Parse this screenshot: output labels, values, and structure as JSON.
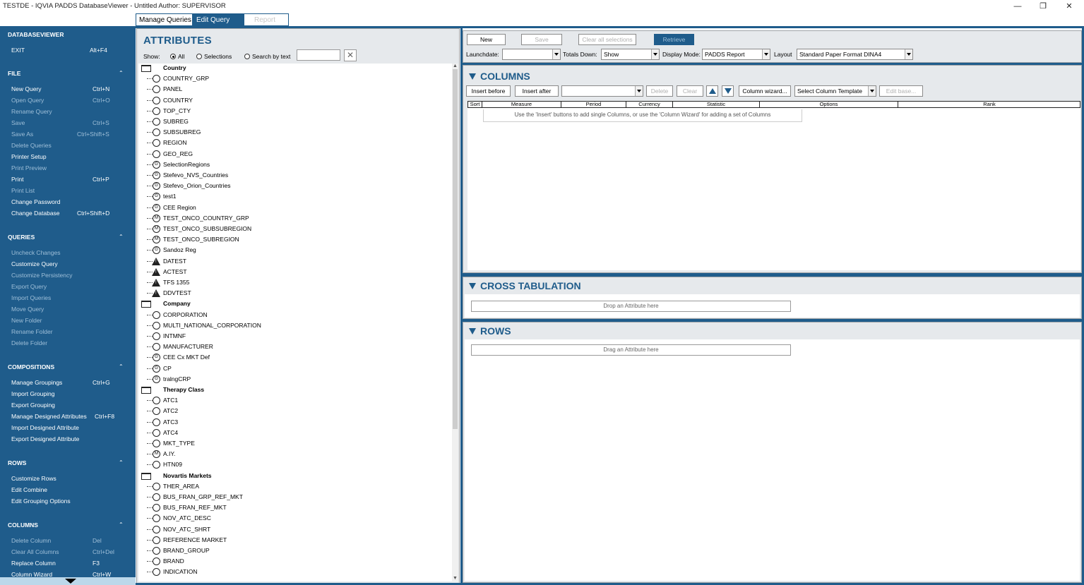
{
  "window": {
    "title": "TESTDE - IQVIA PADDS DatabaseViewer - Untitled  Author: SUPERVISOR",
    "minimize": "—",
    "restore": "❐",
    "close": "✕"
  },
  "tabs": [
    {
      "label": "Manage Queries"
    },
    {
      "label": "Edit Query"
    },
    {
      "label": "Report"
    }
  ],
  "sidebar": {
    "sections": [
      {
        "title": "DATABASEVIEWER",
        "chevron": "",
        "items": [
          {
            "label": "EXIT",
            "key": "Alt+F4",
            "enabled": true
          }
        ]
      },
      {
        "title": "FILE",
        "chevron": "⌃",
        "items": [
          {
            "label": "New Query",
            "key": "Ctrl+N",
            "enabled": true
          },
          {
            "label": "Open Query",
            "key": "Ctrl+O",
            "enabled": false
          },
          {
            "label": "Rename Query",
            "key": "",
            "enabled": false
          },
          {
            "label": "Save",
            "key": "Ctrl+S",
            "enabled": false
          },
          {
            "label": "Save As",
            "key": "Ctrl+Shift+S",
            "enabled": false
          },
          {
            "label": "Delete Queries",
            "key": "",
            "enabled": false
          },
          {
            "label": "Printer Setup",
            "key": "",
            "enabled": true
          },
          {
            "label": "Print Preview",
            "key": "",
            "enabled": false
          },
          {
            "label": "Print",
            "key": "Ctrl+P",
            "enabled": true
          },
          {
            "label": "Print List",
            "key": "",
            "enabled": false
          },
          {
            "label": "Change Password",
            "key": "",
            "enabled": true
          },
          {
            "label": "Change Database",
            "key": "Ctrl+Shift+D",
            "enabled": true
          }
        ]
      },
      {
        "title": "QUERIES",
        "chevron": "⌃",
        "items": [
          {
            "label": "Uncheck Changes",
            "key": "",
            "enabled": false
          },
          {
            "label": "Customize Query",
            "key": "",
            "enabled": true
          },
          {
            "label": "Customize Persistency",
            "key": "",
            "enabled": false
          },
          {
            "label": "Export Query",
            "key": "",
            "enabled": false
          },
          {
            "label": "Import Queries",
            "key": "",
            "enabled": false
          },
          {
            "label": "Move Query",
            "key": "",
            "enabled": false
          },
          {
            "label": "New Folder",
            "key": "",
            "enabled": false
          },
          {
            "label": "Rename Folder",
            "key": "",
            "enabled": false
          },
          {
            "label": "Delete Folder",
            "key": "",
            "enabled": false
          }
        ]
      },
      {
        "title": "COMPOSITIONS",
        "chevron": "⌃",
        "items": [
          {
            "label": "Manage Groupings",
            "key": "Ctrl+G",
            "enabled": true
          },
          {
            "label": "Import Grouping",
            "key": "",
            "enabled": true
          },
          {
            "label": "Export Grouping",
            "key": "",
            "enabled": true
          },
          {
            "label": "Manage Designed Attributes",
            "key": "Ctrl+F8",
            "enabled": true
          },
          {
            "label": "Import Designed Attribute",
            "key": "",
            "enabled": true
          },
          {
            "label": "Export Designed Attribute",
            "key": "",
            "enabled": true
          }
        ]
      },
      {
        "title": "ROWS",
        "chevron": "⌃",
        "items": [
          {
            "label": "Customize Rows",
            "key": "",
            "enabled": true
          },
          {
            "label": "Edit Combine",
            "key": "",
            "enabled": true
          },
          {
            "label": "Edit Grouping Options",
            "key": "",
            "enabled": true
          }
        ]
      },
      {
        "title": "COLUMNS",
        "chevron": "⌃",
        "items": [
          {
            "label": "Delete Column",
            "key": "Del",
            "enabled": false
          },
          {
            "label": "Clear All Columns",
            "key": "Ctrl+Del",
            "enabled": false
          },
          {
            "label": "Replace Column",
            "key": "F3",
            "enabled": true
          },
          {
            "label": "Column Wizard",
            "key": "Ctrl+W",
            "enabled": true
          }
        ]
      }
    ]
  },
  "attributes": {
    "title": "ATTRIBUTES",
    "show_label": "Show:",
    "radio_all": "All",
    "radio_selections": "Selections",
    "radio_search": "Search by text",
    "search_value": "",
    "clear": "✕",
    "tree": [
      {
        "type": "folder",
        "label": "Country"
      },
      {
        "type": "node",
        "icon": "",
        "label": "COUNTRY_GRP"
      },
      {
        "type": "node",
        "icon": "",
        "label": "PANEL"
      },
      {
        "type": "node",
        "icon": "",
        "label": "COUNTRY"
      },
      {
        "type": "node",
        "icon": "",
        "label": "TOP_CTY"
      },
      {
        "type": "node",
        "icon": "",
        "label": "SUBREG"
      },
      {
        "type": "node",
        "icon": "",
        "label": "SUBSUBREG"
      },
      {
        "type": "node",
        "icon": "",
        "label": "REGION"
      },
      {
        "type": "node",
        "icon": "",
        "label": "GEO_REG"
      },
      {
        "type": "node",
        "icon": "G",
        "label": "SelectionRegions"
      },
      {
        "type": "node",
        "icon": "G",
        "label": "Stefevo_NVS_Countries"
      },
      {
        "type": "node",
        "icon": "G",
        "label": "Stefevo_Orion_Countries"
      },
      {
        "type": "node",
        "icon": "G",
        "label": "test1"
      },
      {
        "type": "node",
        "icon": "G",
        "label": "CEE Region"
      },
      {
        "type": "node",
        "icon": "M",
        "label": "TEST_ONCO_COUNTRY_GRP"
      },
      {
        "type": "node",
        "icon": "M",
        "label": "TEST_ONCO_SUBSUBREGION"
      },
      {
        "type": "node",
        "icon": "M",
        "label": "TEST_ONCO_SUBREGION"
      },
      {
        "type": "node",
        "icon": "G",
        "label": "Sandoz Reg"
      },
      {
        "type": "warn",
        "icon": "",
        "label": "DATEST"
      },
      {
        "type": "warn",
        "icon": "",
        "label": "ACTEST"
      },
      {
        "type": "warn",
        "icon": "",
        "label": "TFS 1355"
      },
      {
        "type": "warn",
        "icon": "",
        "label": "DDVTEST"
      },
      {
        "type": "folder",
        "label": "Company"
      },
      {
        "type": "node",
        "icon": "",
        "label": "CORPORATION"
      },
      {
        "type": "node",
        "icon": "",
        "label": "MULTI_NATIONAL_CORPORATION"
      },
      {
        "type": "node",
        "icon": "",
        "label": "INTMNF"
      },
      {
        "type": "node",
        "icon": "",
        "label": "MANUFACTURER"
      },
      {
        "type": "node",
        "icon": "G",
        "label": "CEE Cx MKT Def"
      },
      {
        "type": "node",
        "icon": "G",
        "label": "CP"
      },
      {
        "type": "node",
        "icon": "G",
        "label": "tralngCRP"
      },
      {
        "type": "folder",
        "label": "Therapy Class"
      },
      {
        "type": "node",
        "icon": "",
        "label": "ATC1"
      },
      {
        "type": "node",
        "icon": "",
        "label": "ATC2"
      },
      {
        "type": "node",
        "icon": "",
        "label": "ATC3"
      },
      {
        "type": "node",
        "icon": "",
        "label": "ATC4"
      },
      {
        "type": "node",
        "icon": "",
        "label": "MKT_TYPE"
      },
      {
        "type": "node",
        "icon": "M",
        "label": "A.IY."
      },
      {
        "type": "node",
        "icon": "",
        "label": "HTN09"
      },
      {
        "type": "folder",
        "label": "Novartis Markets"
      },
      {
        "type": "node",
        "icon": "",
        "label": "THER_AREA"
      },
      {
        "type": "node",
        "icon": "",
        "label": "BUS_FRAN_GRP_REF_MKT"
      },
      {
        "type": "node",
        "icon": "",
        "label": "BUS_FRAN_REF_MKT"
      },
      {
        "type": "node",
        "icon": "",
        "label": "NOV_ATC_DESC"
      },
      {
        "type": "node",
        "icon": "",
        "label": "NOV_ATC_SHRT"
      },
      {
        "type": "node",
        "icon": "",
        "label": "REFERENCE MARKET"
      },
      {
        "type": "node",
        "icon": "",
        "label": "BRAND_GROUP"
      },
      {
        "type": "node",
        "icon": "",
        "label": "BRAND"
      },
      {
        "type": "node",
        "icon": "",
        "label": "INDICATION"
      }
    ]
  },
  "toolbar": {
    "new": "New",
    "save": "Save",
    "clear_all": "Clear all selections",
    "retrieve": "Retrieve",
    "launchdate_label": "Launchdate:",
    "launchdate_value": "",
    "totals_label": "Totals Down:",
    "totals_value": "Show",
    "display_label": "Display Mode:",
    "display_value": "PADDS Report",
    "layout_label": "Layout",
    "layout_value": "Standard Paper Format DINA4"
  },
  "columns": {
    "title": "COLUMNS",
    "insert_before": "Insert before",
    "insert_after": "Insert after",
    "combo_value": "",
    "delete": "Delete",
    "clear": "Clear",
    "wizard": "Column wizard...",
    "template": "Select Column Template",
    "edit_base": "Edit base...",
    "headers": [
      "Sort",
      "Measure",
      "Period",
      "Currency",
      "Statistic",
      "Options",
      "Rank"
    ],
    "hint": "Use the 'Insert' buttons to add single Columns, or use the 'Column Wizard' for adding a set of Columns"
  },
  "cross": {
    "title": "CROSS TABULATION",
    "drop": "Drop an Attribute here"
  },
  "rows": {
    "title": "ROWS",
    "drop": "Drag an Attribute here"
  }
}
